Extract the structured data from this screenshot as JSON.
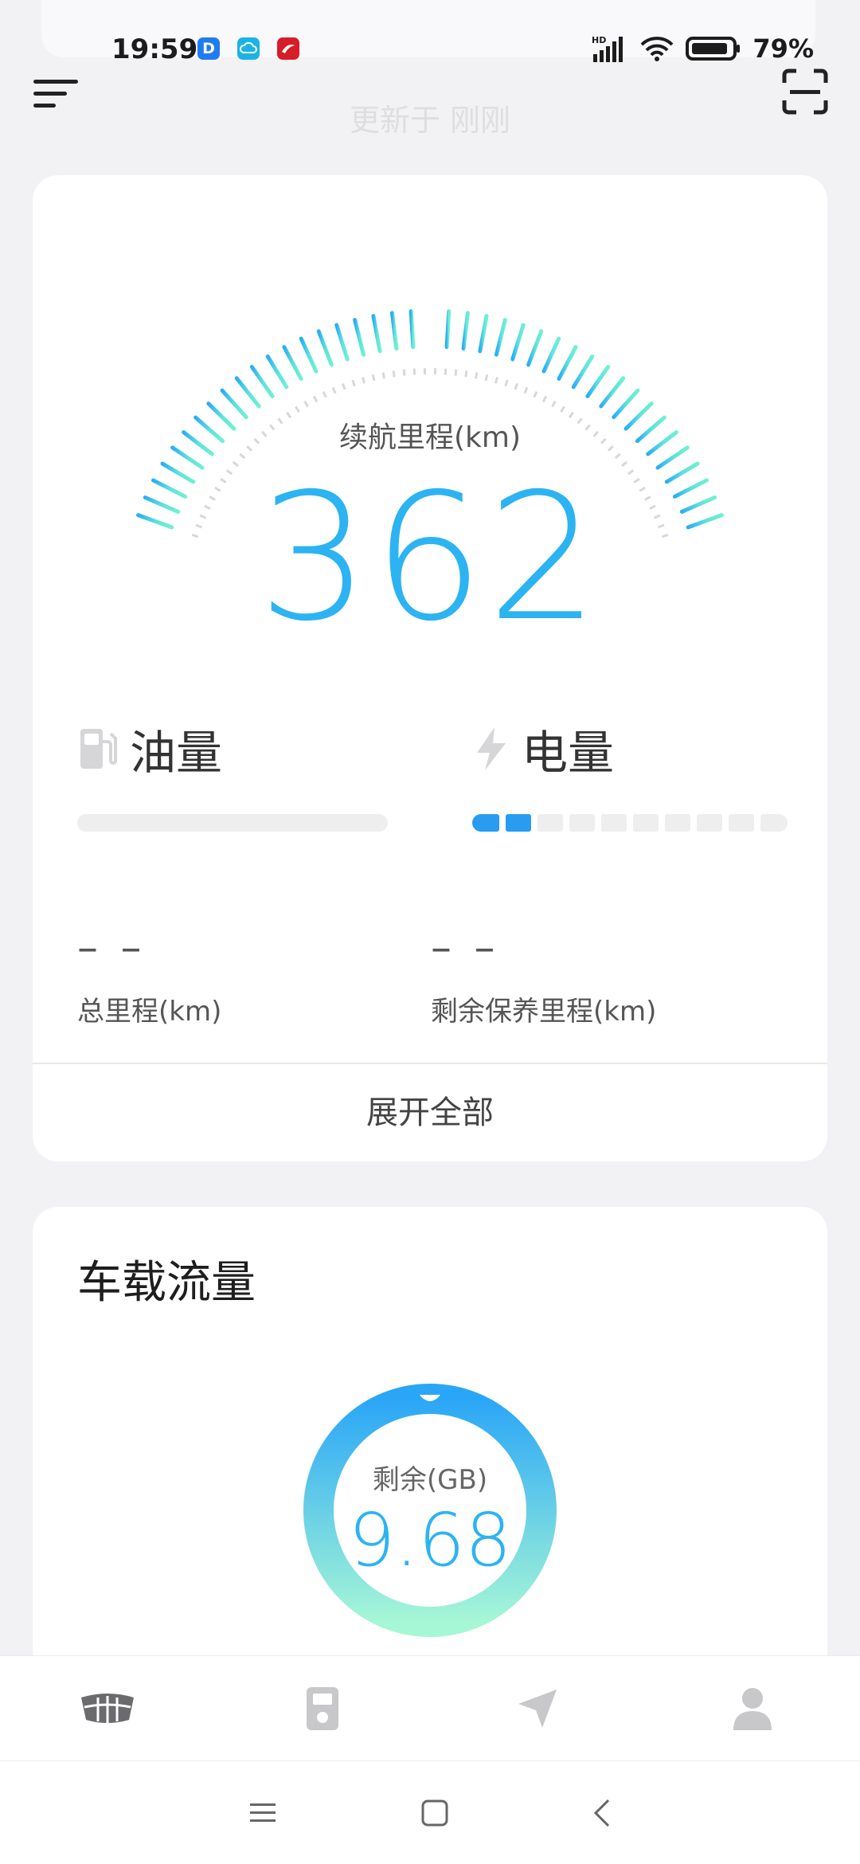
{
  "status_bar": {
    "time": "19:59",
    "apps": [
      {
        "name": "dingtalk-app-icon",
        "glyph": "D",
        "color": "#1f7cf0"
      },
      {
        "name": "cloud-app-icon",
        "glyph": "☁",
        "color": "#1ab3e6"
      },
      {
        "name": "airline-app-icon",
        "glyph": "✈",
        "color": "#d71d27"
      }
    ],
    "network": "HD",
    "battery_percent": "79%"
  },
  "header": {
    "updated_text": "更新于 刚刚"
  },
  "range": {
    "label": "续航里程(km)",
    "value": "362"
  },
  "fuel": {
    "label": "油量"
  },
  "electricity": {
    "label": "电量",
    "segments_total": 10,
    "segments_filled": 2
  },
  "stats": {
    "total_mileage": {
      "value": "– –",
      "label": "总里程(km)"
    },
    "maintenance_mileage": {
      "value": "– –",
      "label": "剩余保养里程(km)"
    }
  },
  "expand_label": "展开全部",
  "data_usage": {
    "title": "车载流量",
    "remaining_label": "剩余(GB)",
    "remaining_value": "9.68"
  },
  "colors": {
    "accent_blue": "#2cb3f2",
    "gauge_start": "#2aaef5",
    "gauge_end": "#6ff0d2",
    "segment_on": "#2a9cf0"
  }
}
